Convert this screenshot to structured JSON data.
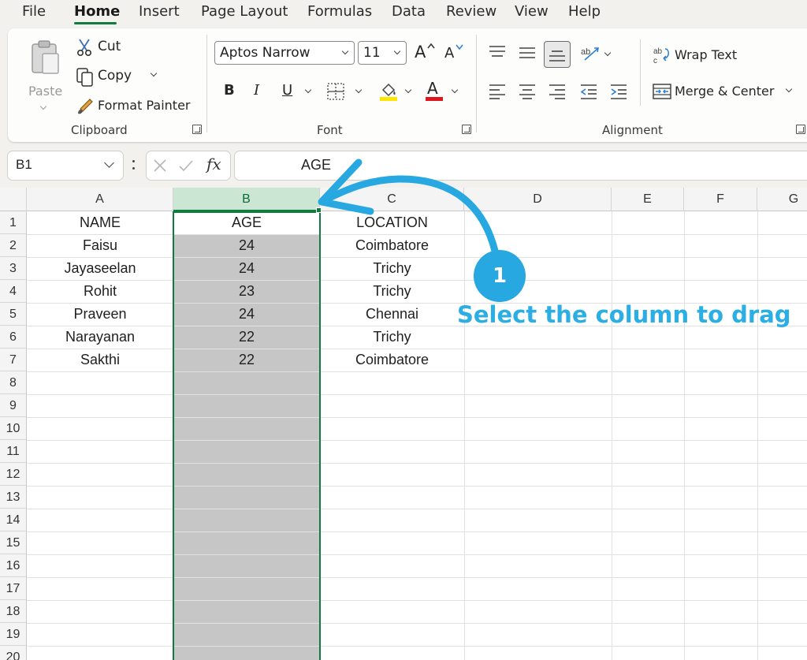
{
  "menu": {
    "tabs": [
      "File",
      "Home",
      "Insert",
      "Page Layout",
      "Formulas",
      "Data",
      "Review",
      "View",
      "Help"
    ],
    "active_tab": "Home"
  },
  "ribbon": {
    "clipboard": {
      "paste_label": "Paste",
      "cut_label": "Cut",
      "copy_label": "Copy",
      "format_painter_label": "Format Painter",
      "group_label": "Clipboard"
    },
    "font": {
      "font_name": "Aptos Narrow",
      "font_size": "11",
      "bold_label": "B",
      "italic_label": "I",
      "underline_label": "U",
      "font_color_label": "A",
      "increase_size_label": "A",
      "decrease_size_label": "A",
      "highlight_color": "#ffe600",
      "font_color": "#e0161e",
      "group_label": "Font"
    },
    "alignment": {
      "wrap_text_label": "Wrap Text",
      "merge_center_label": "Merge & Center",
      "group_label": "Alignment"
    }
  },
  "formula_bar": {
    "name_box": "B1",
    "fx_label": "fx",
    "content": "AGE"
  },
  "sheet": {
    "columns": [
      "A",
      "B",
      "C",
      "D",
      "E",
      "F",
      "G"
    ],
    "selected_column": "B",
    "rows": [
      "1",
      "2",
      "3",
      "4",
      "5",
      "6",
      "7",
      "8",
      "9",
      "10",
      "11",
      "12",
      "13",
      "14",
      "15",
      "16",
      "17",
      "18",
      "19",
      "20"
    ],
    "data": [
      [
        "NAME",
        "AGE",
        "LOCATION"
      ],
      [
        "Faisu",
        "24",
        "Coimbatore"
      ],
      [
        "Jayaseelan",
        "24",
        "Trichy"
      ],
      [
        "Rohit",
        "23",
        "Trichy"
      ],
      [
        "Praveen",
        "24",
        "Chennai"
      ],
      [
        "Narayanan",
        "22",
        "Trichy"
      ],
      [
        "Sakthi",
        "22",
        "Coimbatore"
      ]
    ]
  },
  "annotation": {
    "step_number": "1",
    "text": "Select the column to drag",
    "color": "#2aaee3"
  },
  "colors": {
    "accent_green": "#117a3e",
    "selection_gray": "#c6c6c6",
    "annotation_blue": "#28a8e0"
  }
}
